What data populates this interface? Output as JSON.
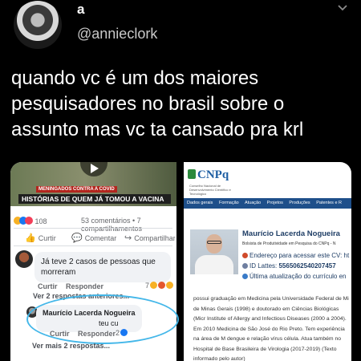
{
  "tweet": {
    "display_name": "a",
    "handle": "@annieclork",
    "text": "quando vc é um dos maiores pesquisadores no brasil sobre o assunto mas vc ta cansado pra krl",
    "menu_icon": "chevron-down-icon"
  },
  "facebook": {
    "video_kicker": "MENINGADOS CONTRA A COVID",
    "video_banner": "HISTÓRIAS DE QUEM JÁ TOMOU A VACINA",
    "reaction_count": "108",
    "comments_shares": "53 comentários • 7 compartilhamentos",
    "actions": {
      "like": "Curtir",
      "comment": "Comentar",
      "share": "Compartilhar"
    },
    "comment1": {
      "text": "Já teve 2 casos de pessoas que morreram",
      "meta_like": "Curtir",
      "meta_reply": "Responder",
      "reactions": "7"
    },
    "view_previous": "Ver 2 respostas anteriores...",
    "reply": {
      "author": "Maurício Lacerda Nogueira",
      "text": "teu cu",
      "meta_like": "Curtir",
      "meta_reply": "Responder",
      "reactions": "2"
    },
    "view_more": "Ver mais 2 respostas..."
  },
  "lattes": {
    "logo": "CNPq",
    "logo_sub": "Conselho Nacional de Desenvolvimento Científico e Tecnológico",
    "nav": [
      "Dados gerais",
      "Formação",
      "Atuação",
      "Projetos",
      "Produções",
      "Patentes e R"
    ],
    "name": "Maurício Lacerda Nogueira",
    "bolsa": "Bolsista de Produtividade em Pesquisa do CNPq - N",
    "endereco": "Endereço para acessar este CV: ht",
    "id_label": "ID Lattes:",
    "id_value": "5565062540207457",
    "atualizacao": "Última atualização do currículo en",
    "bio": "possui graduação em Medicina pela Universidade Federal de Mi de Minas Gerais (1998) e doutorado em Ciências Biológicas (Micr Institute of Allergy and Infectious Diseases (2000 a 2004). Em 2010 Medicina de São José do Rio Preto. Tem experiência na área de M dengue e relação vírus célula. Atua também no Hospital de Base Brasileira de Virologia (2017-2019) (Texto informado pelo autor)"
  },
  "colors": {
    "background": "#000000",
    "handle": "#c9c9c9",
    "circle": "#44b7e9",
    "lattes_nav": "#1e4f8a",
    "cnpq_blue": "#1f5fa3"
  }
}
